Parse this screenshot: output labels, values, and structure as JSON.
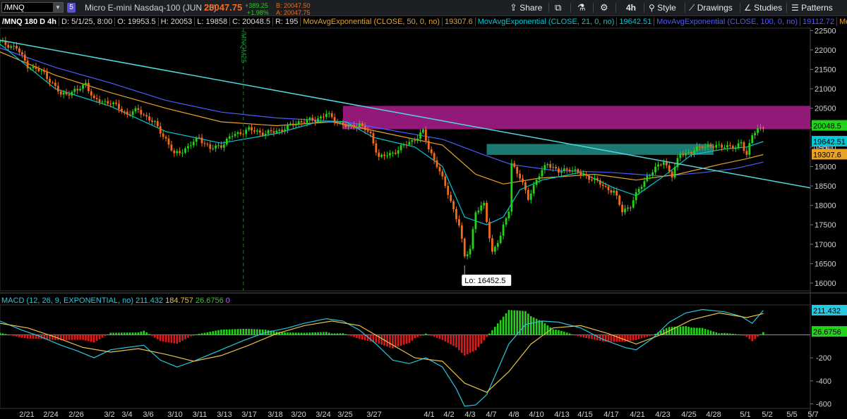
{
  "toolbar": {
    "symbol": "/MNQ",
    "badge": "5",
    "instrument": "Micro E-mini Nasdaq-100 (JUN 25)",
    "last": "20047.75",
    "change": "+389.25",
    "change_pct": "+1.98%",
    "bid": "B: 20047.50",
    "ask": "A: 20047.75",
    "share": "Share",
    "timeframe": "4h",
    "style": "Style",
    "drawings": "Drawings",
    "studies": "Studies",
    "patterns": "Patterns"
  },
  "infobar": {
    "symbol": "/MNQ 180 D 4h",
    "date": "D: 5/1/25, 8:00",
    "open": "O: 19953.5",
    "high": "H: 20053",
    "low": "L: 19858",
    "close": "C: 20048.5",
    "range": "R: 195",
    "ema50_label": "MovAvgExponential (CLOSE, 50, 0, no)",
    "ema50_value": "19307.6",
    "ema21_label": "MovAvgExponential (CLOSE, 21, 0, no)",
    "ema21_value": "19642.51",
    "ema100_label": "MovAvgExponential (CLOSE, 100, 0, no)",
    "ema100_value": "19112.72",
    "more": "MovAvg..."
  },
  "macd_bar": {
    "label": "MACD (12, 26, 9, EXPONENTIAL, no)",
    "value": "211.432",
    "avg": "184.757",
    "diff": "26.6756",
    "zero": "0"
  },
  "price_tags": {
    "last": "20048.5",
    "ema21": "19642.51",
    "ema50": "19307.6",
    "partial": "19500"
  },
  "macd_tags": {
    "value": "211.432",
    "diff": "26.6756"
  },
  "low_label": "Lo: 16452.5",
  "vline_label": "/MNQM25",
  "colors": {
    "up": "#22d31a",
    "down": "#f26b1d",
    "ema21": "#00c8d8",
    "ema50": "#e8a326",
    "ema100": "#4d5cff",
    "trend": "#4fd8e0",
    "zone_magenta": "#9a1a7e",
    "zone_teal": "#1e8078",
    "macd_line": "#28c8e0",
    "macd_avg": "#e8c24a",
    "hist_up": "#22d31a",
    "hist_down": "#e01818",
    "grid": "#2a2a2a"
  },
  "chart_data": {
    "type": "candlestick",
    "y_ticks": [
      22500,
      22000,
      21500,
      21000,
      20500,
      20000,
      19500,
      19000,
      18500,
      18000,
      17500,
      17000,
      16500,
      16000
    ],
    "macd_ticks": [
      -200,
      -400,
      -600
    ],
    "x_ticks": [
      "2/21",
      "2/24",
      "2/26",
      "3/2",
      "3/4",
      "3/6",
      "3/10",
      "3/11",
      "3/13",
      "3/17",
      "3/18",
      "3/20",
      "3/24",
      "3/25",
      "3/27",
      "4/1",
      "4/2",
      "4/3",
      "4/7",
      "4/8",
      "4/10",
      "4/13",
      "4/15",
      "4/17",
      "4/21",
      "4/23",
      "4/25",
      "4/28",
      "5/1",
      "5/2",
      "5/5",
      "5/7"
    ],
    "close_path": [
      [
        0,
        22200
      ],
      [
        6,
        22050
      ],
      [
        10,
        21600
      ],
      [
        16,
        21400
      ],
      [
        22,
        20850
      ],
      [
        28,
        20950
      ],
      [
        31,
        21150
      ],
      [
        34,
        20700
      ],
      [
        40,
        20650
      ],
      [
        46,
        20350
      ],
      [
        50,
        20450
      ],
      [
        56,
        20100
      ],
      [
        60,
        19700
      ],
      [
        63,
        19300
      ],
      [
        68,
        19500
      ],
      [
        72,
        19750
      ],
      [
        76,
        19450
      ],
      [
        80,
        19550
      ],
      [
        84,
        19800
      ],
      [
        90,
        19950
      ],
      [
        96,
        19850
      ],
      [
        102,
        19950
      ],
      [
        108,
        20150
      ],
      [
        114,
        20200
      ],
      [
        118,
        20350
      ],
      [
        122,
        20150
      ],
      [
        126,
        20000
      ],
      [
        130,
        20100
      ],
      [
        134,
        19800
      ],
      [
        137,
        19250
      ],
      [
        141,
        19300
      ],
      [
        145,
        19500
      ],
      [
        149,
        19650
      ],
      [
        153,
        19900
      ],
      [
        155,
        19450
      ],
      [
        158,
        19050
      ],
      [
        162,
        18300
      ],
      [
        166,
        17500
      ],
      [
        168,
        16650
      ],
      [
        170,
        16900
      ],
      [
        172,
        17850
      ],
      [
        175,
        18000
      ],
      [
        178,
        16800
      ],
      [
        181,
        17200
      ],
      [
        184,
        17900
      ],
      [
        185,
        19100
      ],
      [
        188,
        18700
      ],
      [
        191,
        18200
      ],
      [
        194,
        18650
      ],
      [
        198,
        19100
      ],
      [
        202,
        18850
      ],
      [
        206,
        18950
      ],
      [
        210,
        18800
      ],
      [
        214,
        18700
      ],
      [
        218,
        18500
      ],
      [
        222,
        18350
      ],
      [
        225,
        17850
      ],
      [
        228,
        18000
      ],
      [
        231,
        18400
      ],
      [
        234,
        18750
      ],
      [
        238,
        19000
      ],
      [
        240,
        19150
      ],
      [
        243,
        18750
      ],
      [
        246,
        19350
      ],
      [
        250,
        19350
      ],
      [
        254,
        19550
      ],
      [
        258,
        19500
      ],
      [
        262,
        19550
      ],
      [
        266,
        19450
      ],
      [
        268,
        19650
      ],
      [
        270,
        19300
      ],
      [
        272,
        19800
      ],
      [
        274,
        19950
      ],
      [
        276,
        20048.5
      ]
    ],
    "ema21": [
      [
        0,
        22150
      ],
      [
        20,
        21000
      ],
      [
        40,
        20550
      ],
      [
        60,
        19900
      ],
      [
        80,
        19600
      ],
      [
        100,
        19850
      ],
      [
        115,
        20150
      ],
      [
        125,
        20150
      ],
      [
        135,
        19750
      ],
      [
        150,
        19500
      ],
      [
        160,
        19000
      ],
      [
        168,
        17700
      ],
      [
        176,
        17500
      ],
      [
        182,
        17700
      ],
      [
        188,
        18400
      ],
      [
        196,
        18650
      ],
      [
        210,
        18850
      ],
      [
        222,
        18450
      ],
      [
        230,
        18250
      ],
      [
        240,
        18750
      ],
      [
        250,
        19300
      ],
      [
        262,
        19450
      ],
      [
        270,
        19500
      ],
      [
        276,
        19642.51
      ]
    ],
    "ema50": [
      [
        0,
        21950
      ],
      [
        20,
        21350
      ],
      [
        40,
        20900
      ],
      [
        60,
        20500
      ],
      [
        80,
        20150
      ],
      [
        100,
        20050
      ],
      [
        120,
        20150
      ],
      [
        140,
        19850
      ],
      [
        160,
        19550
      ],
      [
        172,
        18800
      ],
      [
        182,
        18550
      ],
      [
        195,
        18700
      ],
      [
        215,
        18800
      ],
      [
        230,
        18650
      ],
      [
        245,
        18800
      ],
      [
        260,
        19050
      ],
      [
        270,
        19200
      ],
      [
        276,
        19307.6
      ]
    ],
    "ema100": [
      [
        0,
        22050
      ],
      [
        20,
        21550
      ],
      [
        40,
        21150
      ],
      [
        60,
        20700
      ],
      [
        80,
        20400
      ],
      [
        100,
        20250
      ],
      [
        125,
        20150
      ],
      [
        140,
        19950
      ],
      [
        160,
        19700
      ],
      [
        175,
        19300
      ],
      [
        185,
        19050
      ],
      [
        200,
        18900
      ],
      [
        220,
        18850
      ],
      [
        240,
        18750
      ],
      [
        255,
        18850
      ],
      [
        266,
        18950
      ],
      [
        276,
        19112.72
      ]
    ],
    "trendline": [
      [
        0,
        22250
      ],
      [
        293,
        18450
      ]
    ],
    "zones": [
      {
        "name": "resistance",
        "x0": 124,
        "x1": 293,
        "y0": 19960,
        "y1": 20560
      },
      {
        "name": "support",
        "x0": 176,
        "x1": 258,
        "y0": 19300,
        "y1": 19580
      }
    ],
    "vertical_line_x": 88,
    "low": {
      "x": 168,
      "y": 16452.5
    },
    "macd_path": [
      [
        0,
        120
      ],
      [
        8,
        40
      ],
      [
        14,
        -10
      ],
      [
        22,
        -90
      ],
      [
        28,
        -140
      ],
      [
        34,
        -200
      ],
      [
        40,
        -130
      ],
      [
        46,
        -110
      ],
      [
        52,
        -90
      ],
      [
        58,
        -220
      ],
      [
        64,
        -280
      ],
      [
        70,
        -230
      ],
      [
        76,
        -170
      ],
      [
        82,
        -110
      ],
      [
        88,
        -50
      ],
      [
        96,
        20
      ],
      [
        104,
        60
      ],
      [
        110,
        100
      ],
      [
        118,
        140
      ],
      [
        124,
        120
      ],
      [
        130,
        40
      ],
      [
        136,
        -80
      ],
      [
        142,
        -220
      ],
      [
        148,
        -250
      ],
      [
        154,
        -200
      ],
      [
        160,
        -280
      ],
      [
        165,
        -470
      ],
      [
        168,
        -620
      ],
      [
        172,
        -610
      ],
      [
        176,
        -520
      ],
      [
        180,
        -300
      ],
      [
        184,
        -80
      ],
      [
        190,
        90
      ],
      [
        196,
        120
      ],
      [
        202,
        110
      ],
      [
        210,
        60
      ],
      [
        218,
        -40
      ],
      [
        226,
        -110
      ],
      [
        230,
        -130
      ],
      [
        236,
        -30
      ],
      [
        242,
        110
      ],
      [
        248,
        190
      ],
      [
        254,
        220
      ],
      [
        262,
        200
      ],
      [
        268,
        160
      ],
      [
        272,
        100
      ],
      [
        276,
        211.432
      ]
    ],
    "macd_avg_path": [
      [
        0,
        100
      ],
      [
        10,
        60
      ],
      [
        20,
        -20
      ],
      [
        30,
        -110
      ],
      [
        40,
        -150
      ],
      [
        50,
        -120
      ],
      [
        60,
        -170
      ],
      [
        70,
        -230
      ],
      [
        80,
        -180
      ],
      [
        90,
        -90
      ],
      [
        100,
        10
      ],
      [
        110,
        80
      ],
      [
        120,
        120
      ],
      [
        130,
        80
      ],
      [
        140,
        -60
      ],
      [
        150,
        -200
      ],
      [
        160,
        -230
      ],
      [
        168,
        -420
      ],
      [
        176,
        -500
      ],
      [
        184,
        -320
      ],
      [
        192,
        -80
      ],
      [
        200,
        60
      ],
      [
        210,
        80
      ],
      [
        220,
        10
      ],
      [
        230,
        -80
      ],
      [
        240,
        10
      ],
      [
        250,
        130
      ],
      [
        260,
        190
      ],
      [
        270,
        150
      ],
      [
        276,
        184.757
      ]
    ]
  }
}
